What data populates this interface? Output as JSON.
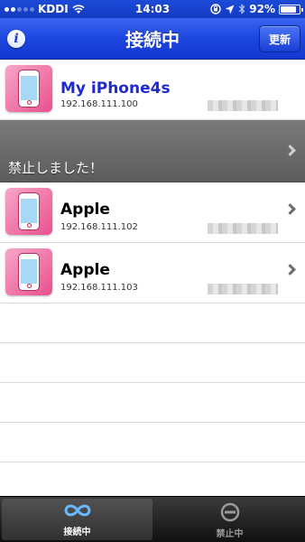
{
  "status_bar": {
    "carrier": "KDDI",
    "time": "14:03",
    "battery_percent": "92%",
    "battery_level": 0.92
  },
  "nav": {
    "title": "接続中",
    "refresh_label": "更新",
    "info_glyph": "i"
  },
  "devices": [
    {
      "name": "My iPhone4s",
      "ip": "192.168.111.100",
      "is_self": true
    },
    {
      "name": "Apple",
      "ip": "192.168.111.102",
      "is_self": false
    },
    {
      "name": "Apple",
      "ip": "192.168.111.103",
      "is_self": false
    }
  ],
  "banned_row": {
    "label": "禁止しました！"
  },
  "tabs": [
    {
      "label": "接続中",
      "icon": "infinity-icon",
      "active": true
    },
    {
      "label": "禁止中",
      "icon": "no-entry-icon",
      "active": false
    }
  ],
  "colors": {
    "nav_blue": "#1d46e0",
    "self_name": "#1f2bd0",
    "banned_bg": "#6a6a6a"
  }
}
